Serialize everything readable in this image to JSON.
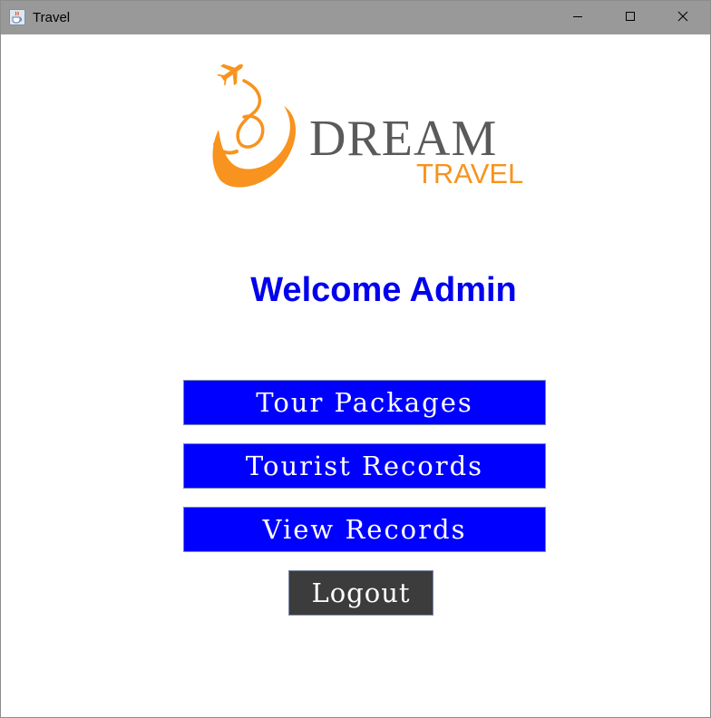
{
  "window": {
    "title": "Travel",
    "icon": "java-cup-icon",
    "controls": {
      "minimize": "minimize-icon",
      "maximize": "maximize-icon",
      "close": "close-icon"
    }
  },
  "logo": {
    "word1": "DREAM",
    "word2": "TRAVEL",
    "colors": {
      "orange": "#f7931e",
      "gray": "#5a5a5a"
    }
  },
  "main": {
    "welcome": "Welcome Admin",
    "welcome_color": "#0000ee",
    "buttons": {
      "tour_packages": "Tour Packages",
      "tourist_records": "Tourist Records",
      "view_records": "View Records",
      "logout": "Logout"
    },
    "button_color": "#0000ff",
    "logout_color": "#3c3c3c"
  }
}
